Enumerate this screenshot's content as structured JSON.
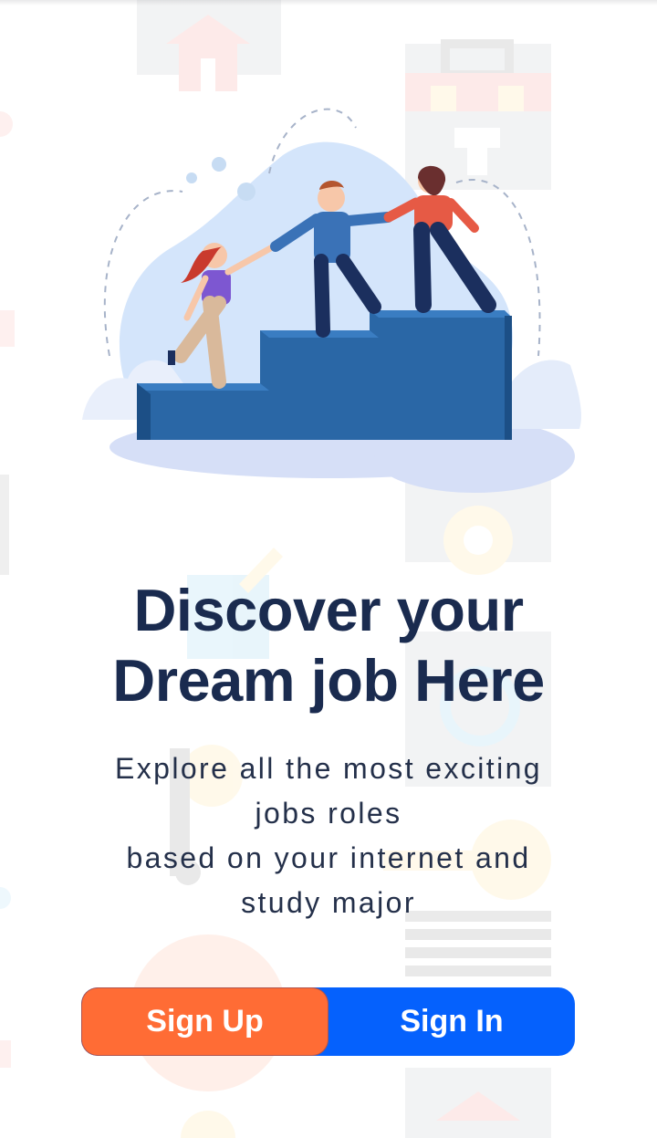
{
  "onboarding": {
    "headline_line1": "Discover your",
    "headline_line2": "Dream job Here",
    "subtitle_line1": "Explore all the most exciting",
    "subtitle_line2": "jobs roles",
    "subtitle_line3": "based on your internet and",
    "subtitle_line4": "study major",
    "illustration_icon": "team-climbing-stairs-illustration",
    "background_icons": [
      "house-icon",
      "toolbox-icon",
      "gear-icon",
      "key-icon",
      "pencil-icon",
      "document-icon",
      "magnifier-icon"
    ]
  },
  "auth": {
    "signup_label": "Sign Up",
    "signin_label": "Sign In"
  },
  "colors": {
    "headline": "#1a2b4f",
    "signup": "#ff6c35",
    "signin": "#0561fd",
    "stairs": "#2a67a6"
  }
}
